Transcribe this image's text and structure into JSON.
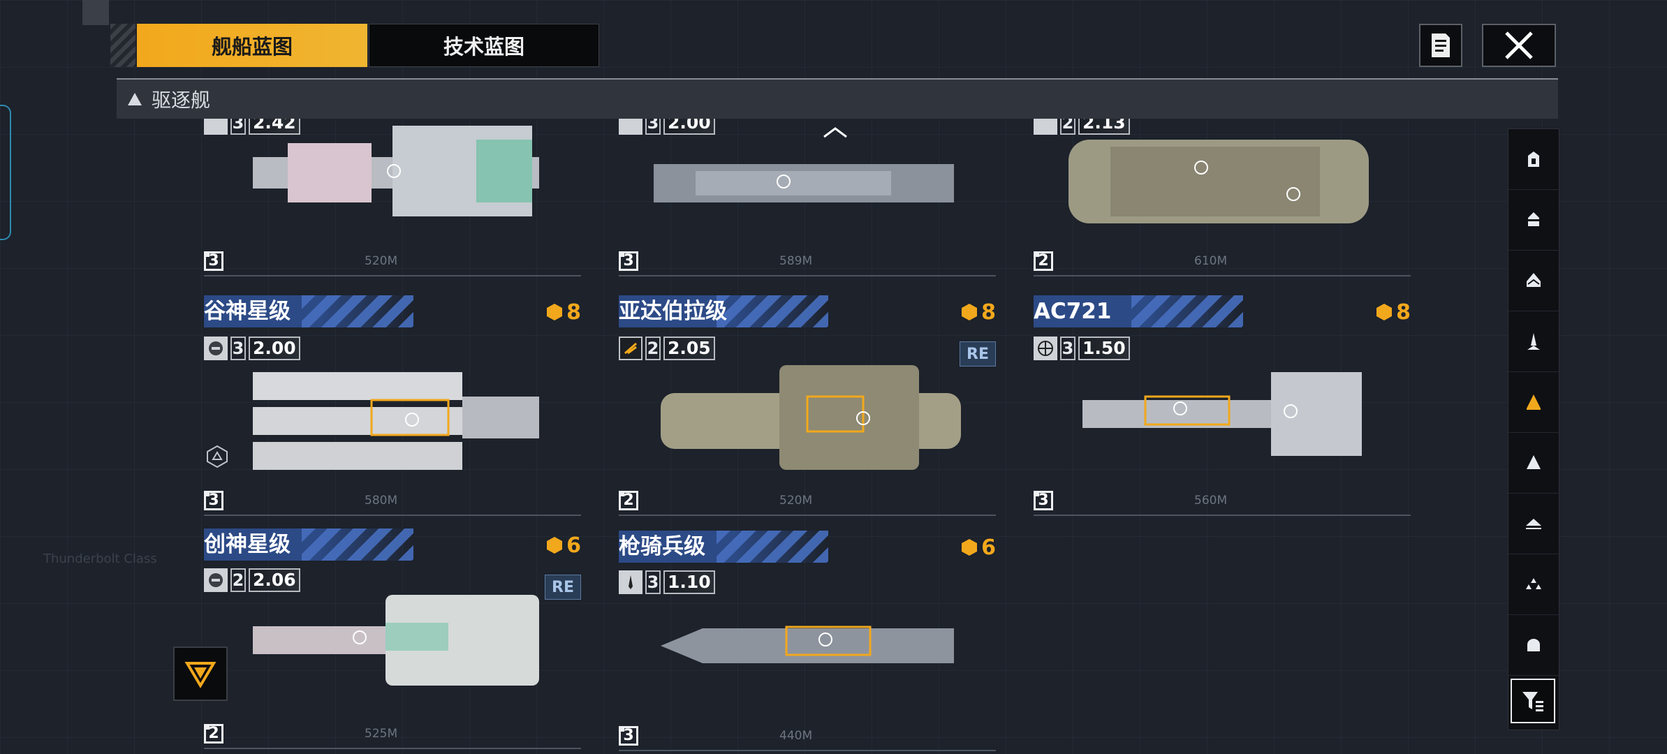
{
  "tabs": [
    {
      "label": "舰船蓝图",
      "active": true
    },
    {
      "label": "技术蓝图",
      "active": false
    }
  ],
  "category": {
    "label": "驱逐舰",
    "icon": "destroyer-triangle-icon"
  },
  "top_row": [
    {
      "tier": "3",
      "cost": "2.42",
      "rarity": "3",
      "length": "520M"
    },
    {
      "tier": "3",
      "cost": "2.00",
      "rarity": "3",
      "length": "589M"
    },
    {
      "tier": "2",
      "cost": "2.13",
      "rarity": "2",
      "length": "610M"
    }
  ],
  "ships": [
    {
      "name": "谷神星级",
      "level": "8",
      "tier": "3",
      "cost": "2.00",
      "rarity": "3",
      "length": "580M",
      "re": "",
      "icon": "helmet-icon"
    },
    {
      "name": "亚达伯拉级",
      "level": "8",
      "tier": "2",
      "cost": "2.05",
      "rarity": "2",
      "length": "520M",
      "re": "RE",
      "icon": "emblem-icon"
    },
    {
      "name": "AC721",
      "level": "8",
      "tier": "3",
      "cost": "1.50",
      "rarity": "3",
      "length": "560M",
      "re": "",
      "icon": "globe-icon"
    },
    {
      "name": "创神星级",
      "level": "6",
      "tier": "2",
      "cost": "2.06",
      "rarity": "2",
      "length": "525M",
      "re": "RE",
      "icon": "helmet-icon"
    },
    {
      "name": "枪骑兵级",
      "level": "6",
      "tier": "3",
      "cost": "1.10",
      "rarity": "3",
      "length": "440M",
      "re": "",
      "icon": "jet-icon"
    }
  ],
  "rail": [
    "carrier-icon",
    "cruiser-icon",
    "frigate-icon",
    "corvette-icon",
    "destroyer-icon",
    "battleship-icon",
    "aux-ship-icon",
    "fighter-icon",
    "special-icon"
  ],
  "rail_active_index": 4,
  "colors": {
    "accent": "#f2a81c",
    "name_bar": "#2c4a86",
    "background": "#1d222b"
  }
}
